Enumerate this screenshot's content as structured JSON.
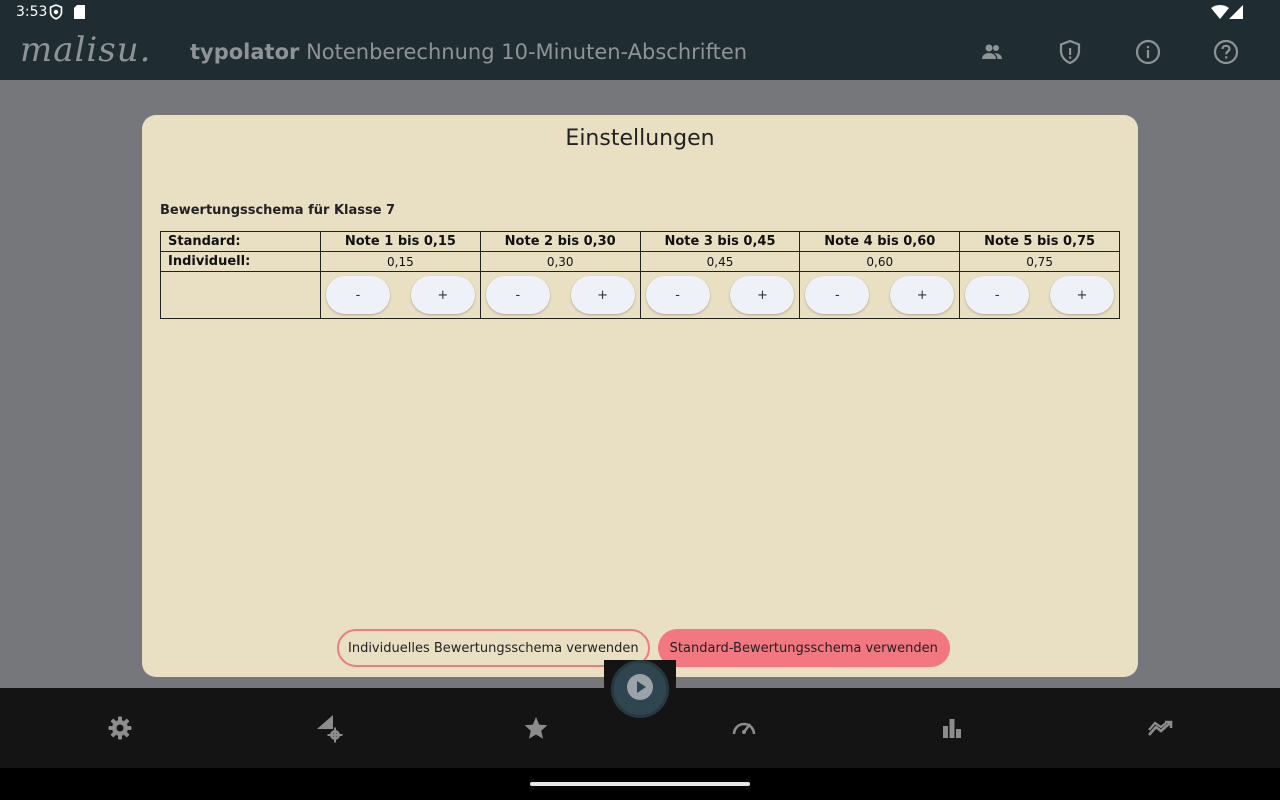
{
  "status_bar": {
    "time": "3:53",
    "icons": [
      "shield-status-icon",
      "sd-card-icon",
      "wifi-icon",
      "battery-icon"
    ]
  },
  "app_bar": {
    "logo": "malisu.",
    "title_bold": "typolator",
    "title_rest": " Notenberechnung 10-Minuten-Abschriften",
    "actions": [
      "people-icon",
      "shield-icon",
      "info-icon",
      "help-icon"
    ]
  },
  "dialog": {
    "title": "Einstellungen",
    "section_title": "Bewertungsschema für Klasse 7",
    "table": {
      "standard_label": "Standard:",
      "individual_label": "Individuell:",
      "grades": [
        {
          "header": "Note 1 bis 0,15",
          "value": "0,15"
        },
        {
          "header": "Note 2 bis 0,30",
          "value": "0,30"
        },
        {
          "header": "Note 3 bis 0,45",
          "value": "0,45"
        },
        {
          "header": "Note 4 bis 0,60",
          "value": "0,60"
        },
        {
          "header": "Note 5 bis 0,75",
          "value": "0,75"
        }
      ],
      "minus_label": "-",
      "plus_label": "+"
    },
    "btn_individual": "Individuelles Bewertungsschema verwenden",
    "btn_standard": "Standard-Bewertungsschema verwenden"
  },
  "colors": {
    "app_bar": "#1f2d33",
    "dialog_bg": "#e9e0c4",
    "accent": "#f27780",
    "bottom_bar": "#141414"
  },
  "bottom_nav": [
    "settings-icon",
    "signal-settings-icon",
    "star-icon",
    "speedometer-icon",
    "bar-chart-icon",
    "trending-icon"
  ],
  "fab": "play-icon"
}
